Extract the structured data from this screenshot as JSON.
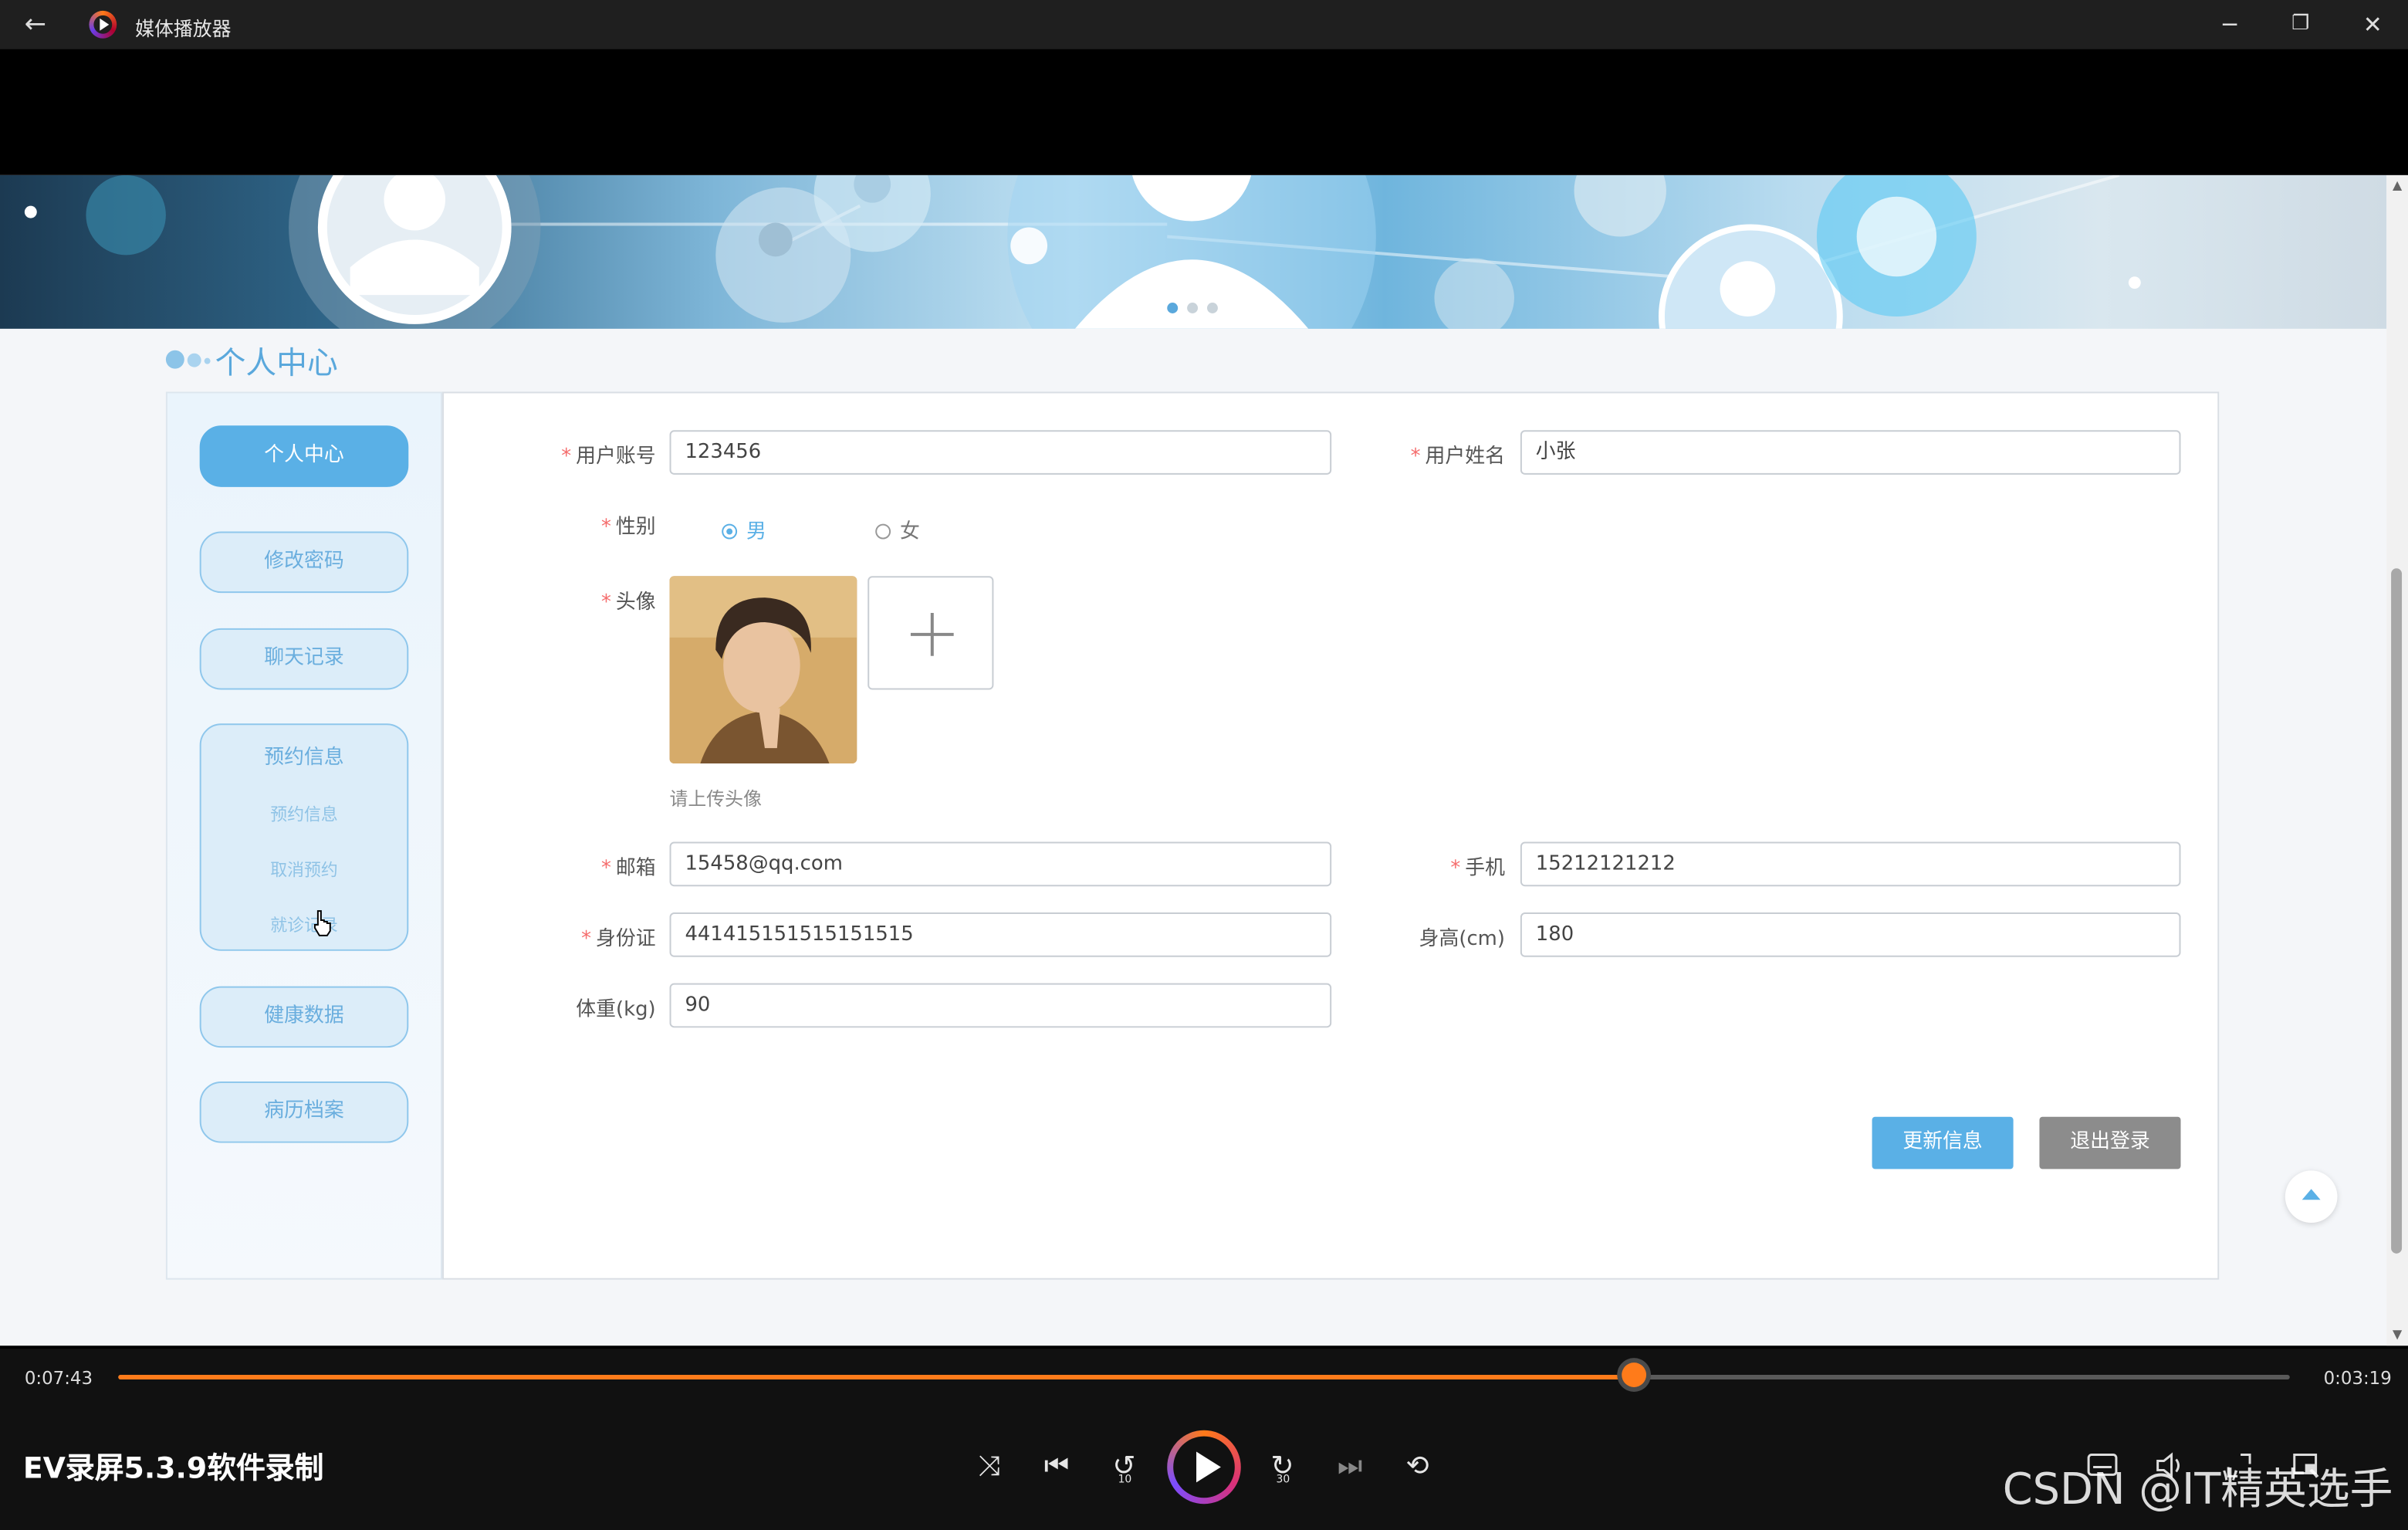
{
  "window": {
    "title": "媒体播放器",
    "back_icon": "←",
    "minimize": "─",
    "restore": "❐",
    "close": "✕"
  },
  "page": {
    "section_title": "个人中心",
    "sidebar": {
      "items": [
        {
          "label": "个人中心",
          "active": true
        },
        {
          "label": "修改密码"
        },
        {
          "label": "聊天记录"
        }
      ],
      "group": {
        "label": "预约信息",
        "children": [
          "预约信息",
          "取消预约",
          "就诊记录"
        ]
      },
      "items_after": [
        {
          "label": "健康数据"
        },
        {
          "label": "病历档案"
        }
      ]
    },
    "form": {
      "account_label": "用户账号",
      "account_value": "123456",
      "name_label": "用户姓名",
      "name_value": "小张",
      "gender_label": "性别",
      "gender_male": "男",
      "gender_female": "女",
      "gender_selected": "男",
      "avatar_label": "头像",
      "avatar_hint": "请上传头像",
      "email_label": "邮箱",
      "email_value": "15458@qq.com",
      "phone_label": "手机",
      "phone_value": "15212121212",
      "id_label": "身份证",
      "id_value": "441415151515151515",
      "height_label": "身高(cm)",
      "height_value": "180",
      "weight_label": "体重(kg)",
      "weight_value": "90",
      "required_mark": "*"
    },
    "buttons": {
      "update": "更新信息",
      "logout": "退出登录"
    },
    "colors": {
      "accent": "#5ab0e6",
      "update_button": "#5ab0e6",
      "logout_button": "#8c8c8c",
      "required": "#f56c6c"
    }
  },
  "player": {
    "elapsed": "0:07:43",
    "remaining": "0:03:19",
    "progress_fraction": 0.698,
    "media_title": "EV录屏5.3.9软件录制",
    "watermark": "CSDN @IT精英选手",
    "icons": {
      "shuffle": "⤨",
      "previous": "⏮",
      "rewind": "↺",
      "rewind_label": "10",
      "forward": "↻",
      "forward_label": "30",
      "next": "⏭",
      "repeat": "⟲",
      "play": "play-icon"
    },
    "accent": "#ff7b1a"
  }
}
